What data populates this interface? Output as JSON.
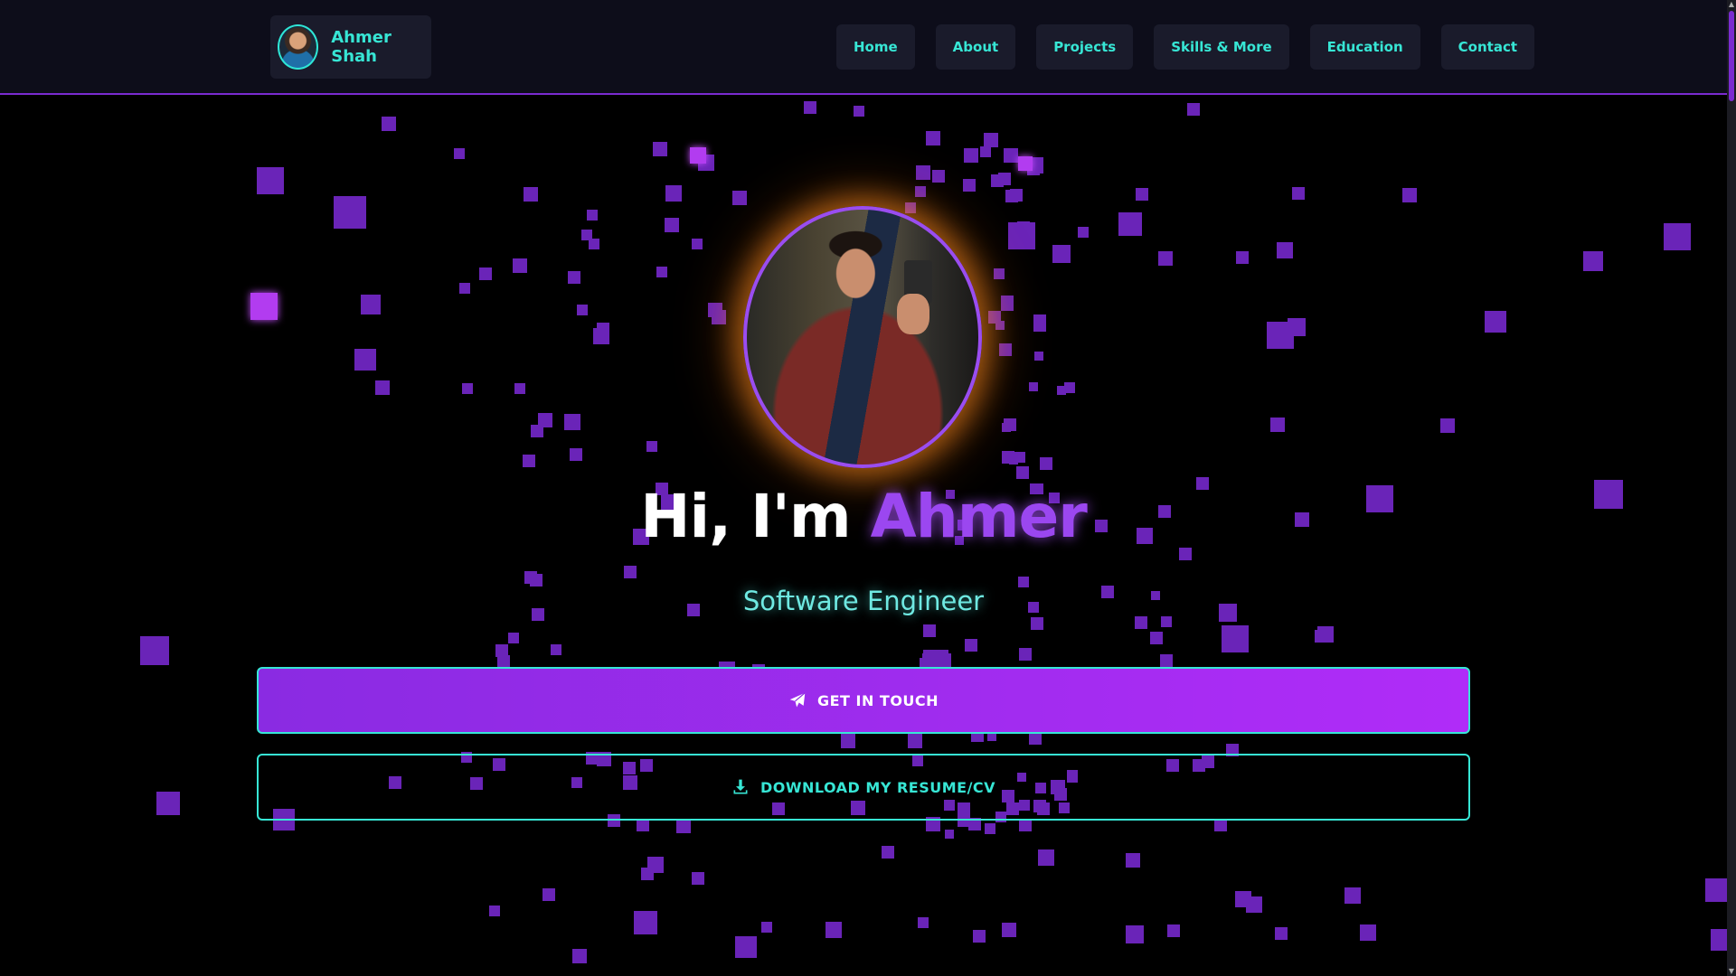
{
  "navbar": {
    "brand_name": "Ahmer Shah",
    "links": [
      "Home",
      "About",
      "Projects",
      "Skills & More",
      "Education",
      "Contact"
    ]
  },
  "hero": {
    "title_prefix": "Hi, I'm",
    "title_name": "Ahmer",
    "subtitle": "Software Engineer",
    "primary_button": "GET IN TOUCH",
    "secondary_button": "DOWNLOAD MY RESUME/CV"
  },
  "colors": {
    "accent_cyan": "#37e6d5",
    "accent_purple": "#9b47f0",
    "nav_background": "#0d0d1a",
    "page_background": "#000000"
  },
  "icons": {
    "primary_button": "paper-plane-icon",
    "secondary_button": "download-icon"
  }
}
